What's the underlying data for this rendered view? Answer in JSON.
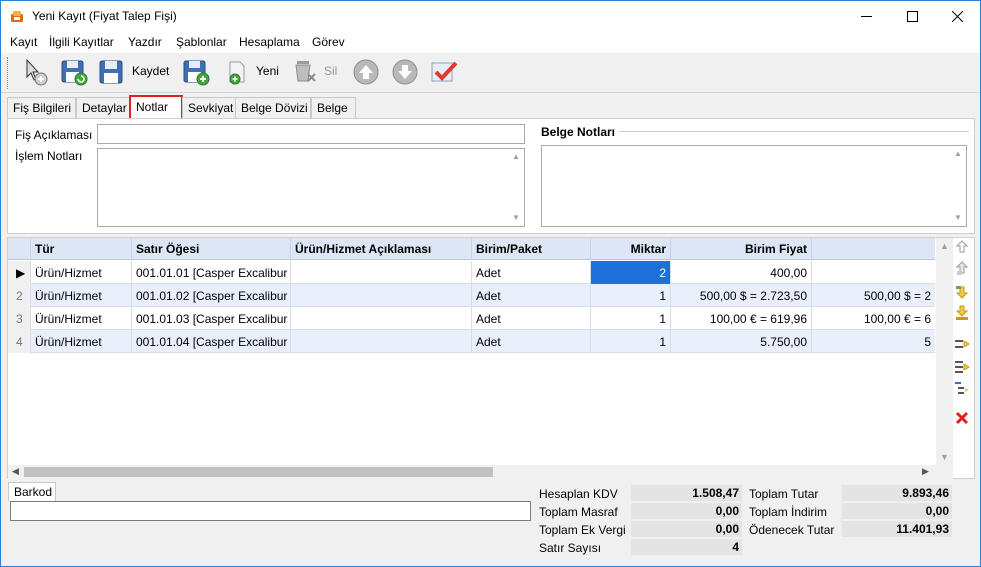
{
  "window": {
    "title": "Yeni Kayıt (Fiyat Talep Fişi)"
  },
  "menu": [
    "Kayıt",
    "İlgili Kayıtlar",
    "Yazdır",
    "Şablonlar",
    "Hesaplama",
    "Görev"
  ],
  "toolbar": {
    "save_label": "Kaydet",
    "new_label": "Yeni",
    "delete_label": "Sil"
  },
  "tabs": [
    "Fiş Bilgileri",
    "Detaylar",
    "Notlar",
    "Sevkiyat",
    "Belge Dövizi",
    "Belge"
  ],
  "active_tab": "Notlar",
  "notes": {
    "fis_aciklamasi_label": "Fiş Açıklaması",
    "fis_aciklamasi_value": "",
    "islem_notlari_label": "İşlem Notları",
    "islem_notlari_value": "",
    "belge_notlari_title": "Belge Notları",
    "belge_notlari_value": ""
  },
  "grid": {
    "columns": [
      "Tür",
      "Satır Öğesi",
      "Ürün/Hizmet Açıklaması",
      "Birim/Paket",
      "Miktar",
      "Birim Fiyat",
      ""
    ],
    "rows": [
      {
        "indicator": "▶",
        "tur": "Ürün/Hizmet",
        "satir": "001.01.01 [Casper Excalibur ...",
        "aciklama": "",
        "birim": "Adet",
        "miktar": "2",
        "fiyat": "400,00",
        "extra": ""
      },
      {
        "indicator": "2",
        "tur": "Ürün/Hizmet",
        "satir": "001.01.02 [Casper Excalibur ...",
        "aciklama": "",
        "birim": "Adet",
        "miktar": "1",
        "fiyat": "500,00 $ = 2.723,50",
        "extra": "500,00 $ = 2"
      },
      {
        "indicator": "3",
        "tur": "Ürün/Hizmet",
        "satir": "001.01.03 [Casper Excalibur ...",
        "aciklama": "",
        "birim": "Adet",
        "miktar": "1",
        "fiyat": "100,00 € = 619,96",
        "extra": "100,00 € = 6"
      },
      {
        "indicator": "4",
        "tur": "Ürün/Hizmet",
        "satir": "001.01.04 [Casper Excalibur ...",
        "aciklama": "",
        "birim": "Adet",
        "miktar": "1",
        "fiyat": "5.750,00",
        "extra": "5"
      }
    ]
  },
  "barkod": {
    "tab_label": "Barkod",
    "value": ""
  },
  "summary": {
    "hesaplan_kdv_label": "Hesaplan KDV",
    "hesaplan_kdv": "1.508,47",
    "toplam_masraf_label": "Toplam Masraf",
    "toplam_masraf": "0,00",
    "toplam_ek_vergi_label": "Toplam Ek Vergi",
    "toplam_ek_vergi": "0,00",
    "satir_sayisi_label": "Satır Sayısı",
    "satir_sayisi": "4",
    "toplam_tutar_label": "Toplam Tutar",
    "toplam_tutar": "9.893,46",
    "toplam_indirim_label": "Toplam İndirim",
    "toplam_indirim": "0,00",
    "odenecek_tutar_label": "Ödenecek Tutar",
    "odenecek_tutar": "11.401,93"
  }
}
